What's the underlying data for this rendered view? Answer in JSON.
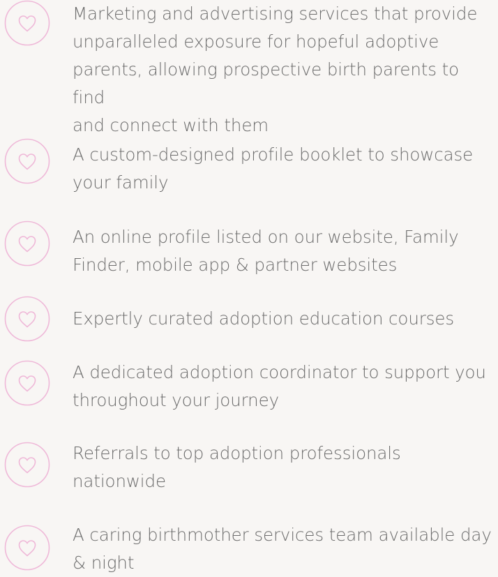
{
  "accent_color": "#efb8d8",
  "text_color": "#6c6c6c",
  "background_color": "#f8f6f4",
  "icon_name": "heart-icon",
  "features": [
    {
      "line1": "Marketing and advertising services that provide",
      "line2": "unparalleled exposure for hopeful adoptive",
      "line3": "parents, allowing prospective birth parents to find",
      "line4": "and connect with them"
    },
    {
      "line1": "A custom-designed profile booklet to showcase",
      "line2": "your family"
    },
    {
      "line1": "An online profile listed on our website, Family",
      "line2": "Finder, mobile app & partner websites"
    },
    {
      "line1": "Expertly curated adoption education courses"
    },
    {
      "line1": "A dedicated adoption coordinator to support you",
      "line2": "throughout your journey"
    },
    {
      "line1": "Referrals to top adoption professionals",
      "line2": "nationwide"
    },
    {
      "line1": "A caring birthmother services team available day",
      "line2": "& night"
    }
  ]
}
